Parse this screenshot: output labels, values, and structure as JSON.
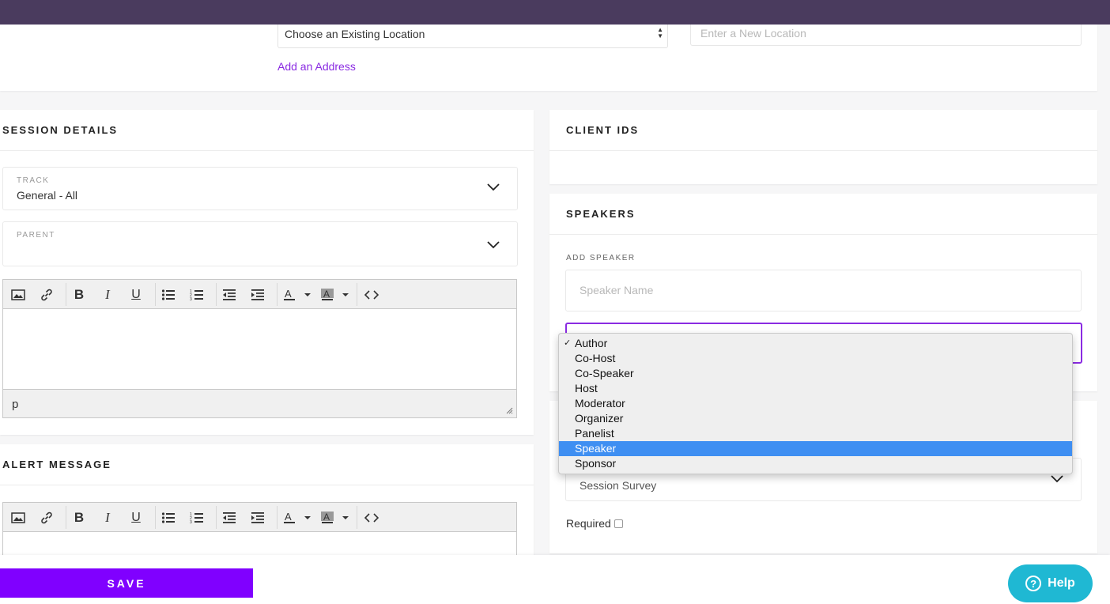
{
  "location": {
    "existing_select_value": "Choose an Existing Location",
    "new_location_placeholder": "Enter a New Location",
    "add_address_link": "Add an Address"
  },
  "session_details": {
    "title": "SESSION DETAILS",
    "track_label": "TRACK",
    "track_value": "General - All",
    "parent_label": "PARENT",
    "parent_value": "",
    "editor_status_path": "p"
  },
  "alert_message": {
    "title": "ALERT MESSAGE"
  },
  "client_ids": {
    "title": "CLIENT IDS"
  },
  "speakers": {
    "title": "SPEAKERS",
    "add_speaker_label": "ADD SPEAKER",
    "speaker_name_placeholder": "Speaker Name",
    "role_options": [
      "Author",
      "Co-Host",
      "Co-Speaker",
      "Host",
      "Moderator",
      "Organizer",
      "Panelist",
      "Speaker",
      "Sponsor"
    ],
    "checked_option": "Author",
    "highlighted_option": "Speaker"
  },
  "survey": {
    "select_value": "Session Survey",
    "required_label": "Required"
  },
  "footer": {
    "save_label": "SAVE",
    "help_label": "Help",
    "help_glyph": "?"
  },
  "colors": {
    "topbar": "#4a3b5e",
    "accent": "#8000ff",
    "link": "#8a2be2",
    "help": "#1fb8d3",
    "option_highlight": "#3f8ff2"
  }
}
